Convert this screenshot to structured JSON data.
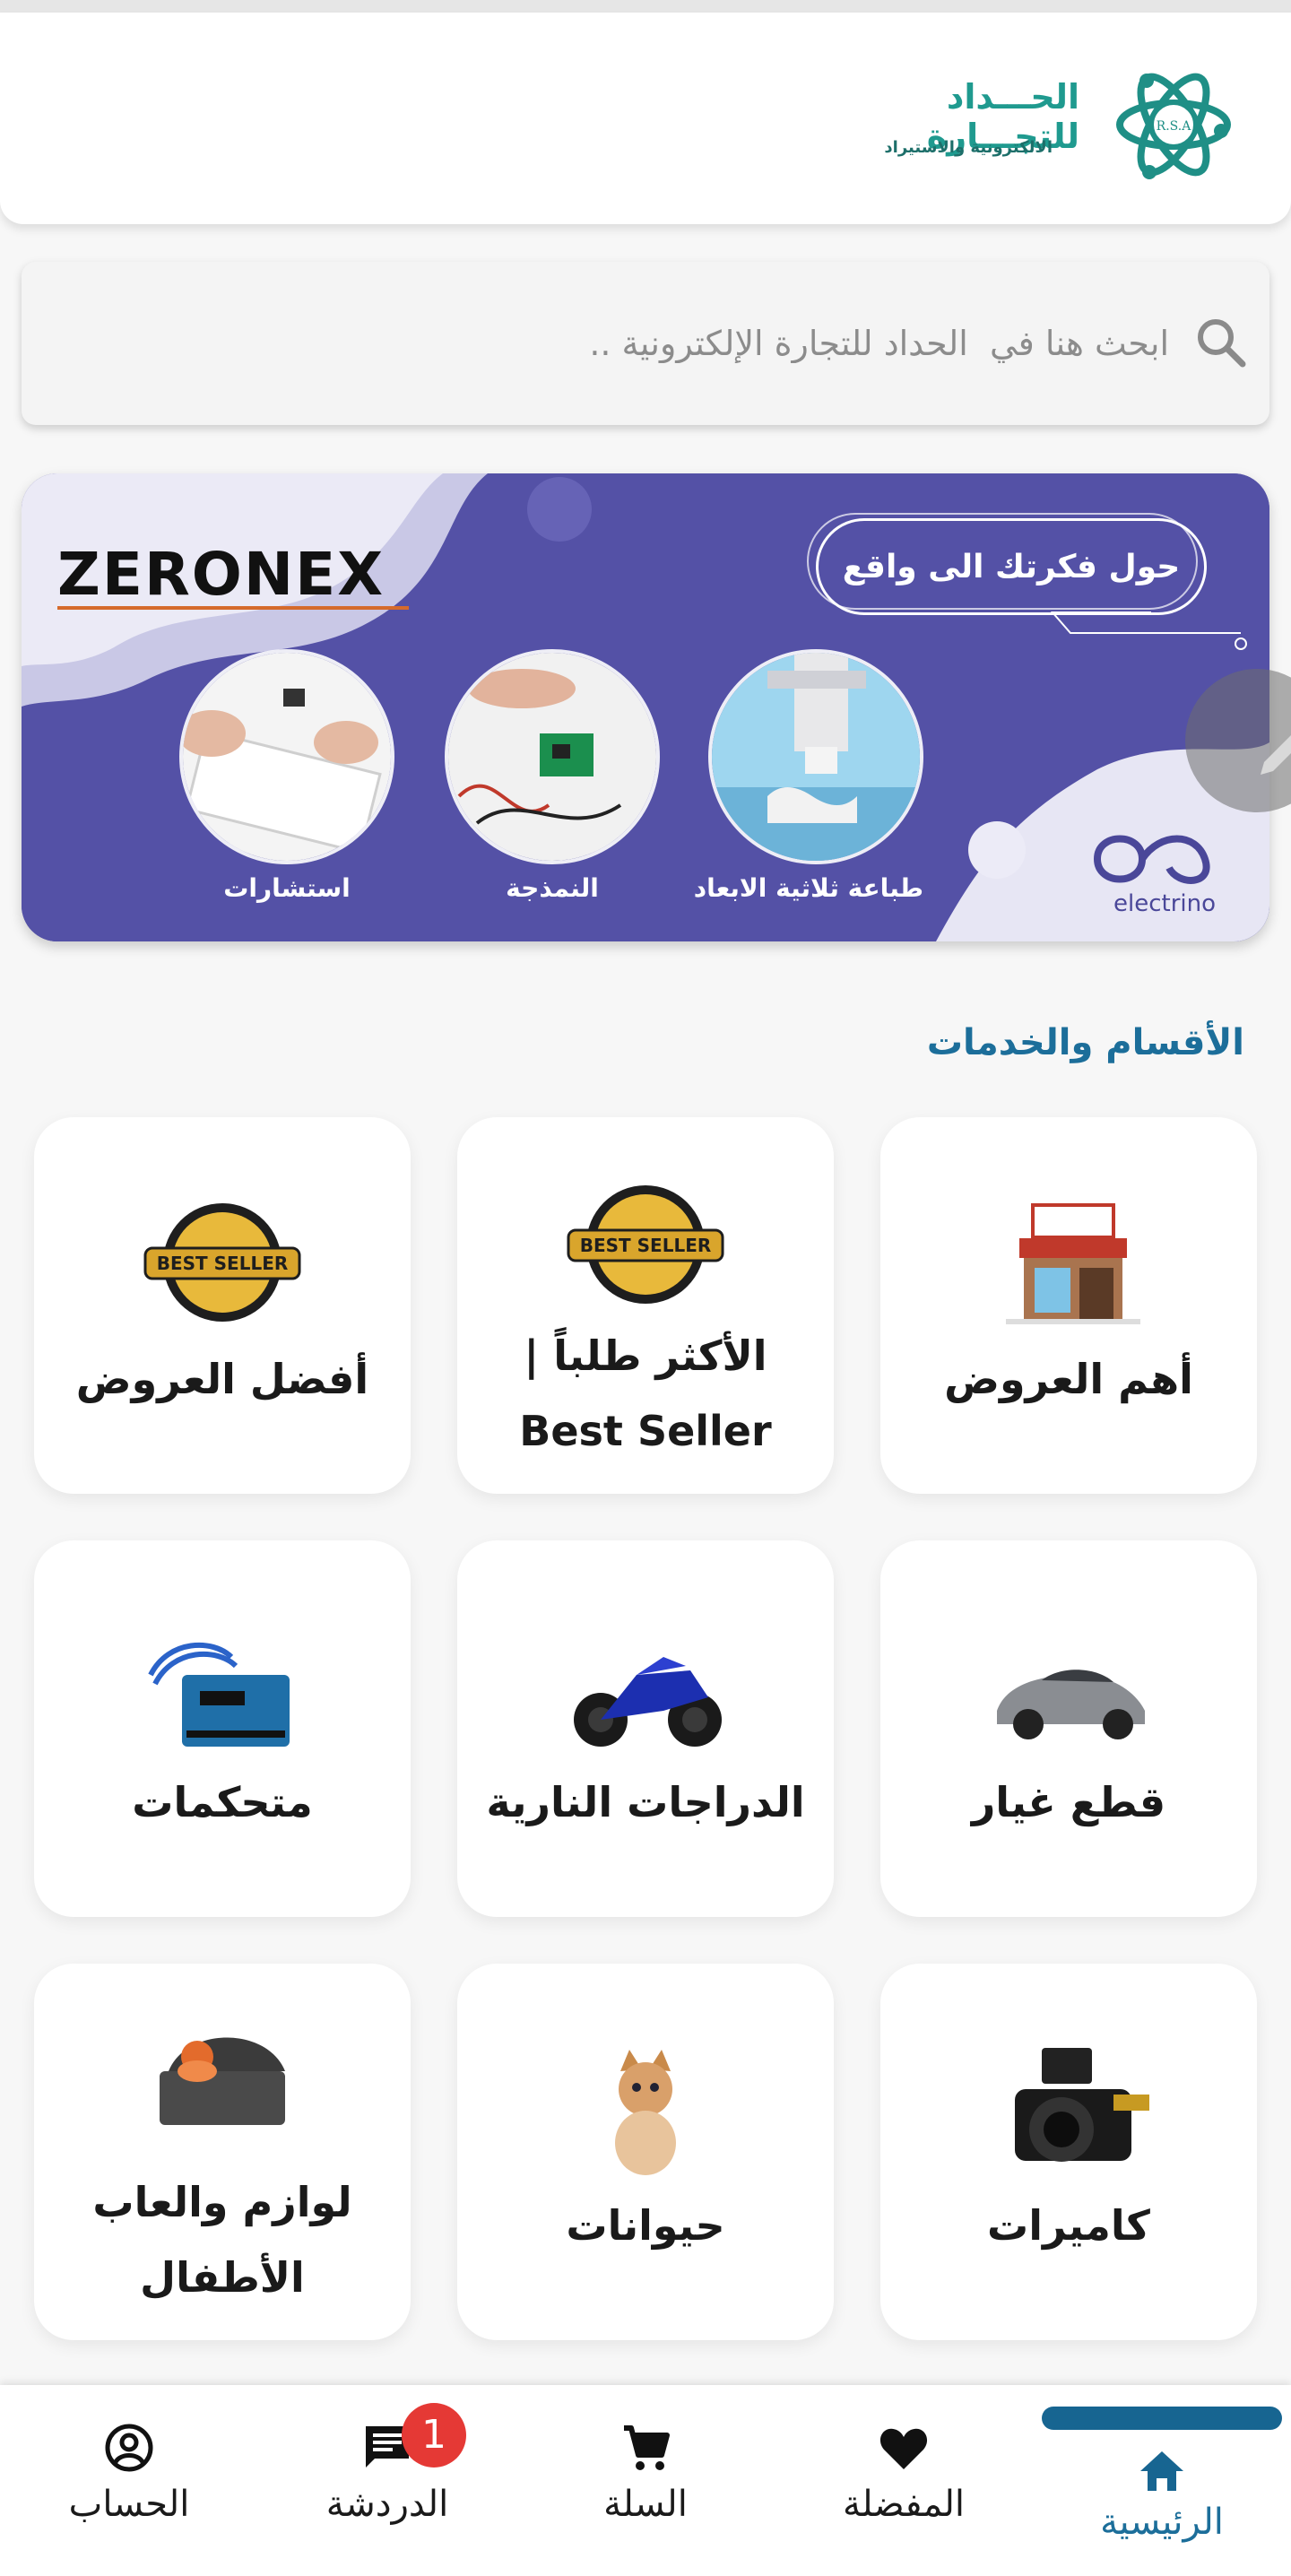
{
  "brand": {
    "name": "الحـــداد للتجـــارة",
    "sub": "الالكترونية والاستيراد",
    "monogram": "R.S.A",
    "color": "#1f9a8f"
  },
  "search": {
    "placeholder": "ابحث هنا في  الحداد للتجارة الإلكترونية .."
  },
  "banner": {
    "tagline": "حول فكرتك الى واقع",
    "brand_left": "ZERONEX",
    "brand_right": "electrino",
    "services": [
      "طباعة ثلاثية الابعاد",
      "النمذجة",
      "استشارات"
    ],
    "bg_color": "#5451a6"
  },
  "section": {
    "title": "الأقسام والخدمات"
  },
  "categories": [
    {
      "label": "أهم العروض",
      "icon": "shop-icon"
    },
    {
      "label": "الأكثر طلباً | Best Seller",
      "icon": "best-seller-badge-icon"
    },
    {
      "label": "أفضل العروض",
      "icon": "best-seller-badge-icon"
    },
    {
      "label": "قطع غيار",
      "icon": "car-icon"
    },
    {
      "label": "الدراجات النارية",
      "icon": "motorcycle-icon"
    },
    {
      "label": "متحكمات",
      "icon": "arduino-board-icon"
    },
    {
      "label": "كاميرات",
      "icon": "camera-icon"
    },
    {
      "label": "حيوانات",
      "icon": "kitten-icon"
    },
    {
      "label": "لوازم والعاب الأطفال",
      "icon": "baby-stroller-icon"
    }
  ],
  "nav": {
    "home": "الرئيسية",
    "favorites": "المفضلة",
    "cart": "السلة",
    "chat": "الدردشة",
    "account": "الحساب",
    "chat_badge": "1",
    "active_color": "#1c6e9a"
  }
}
